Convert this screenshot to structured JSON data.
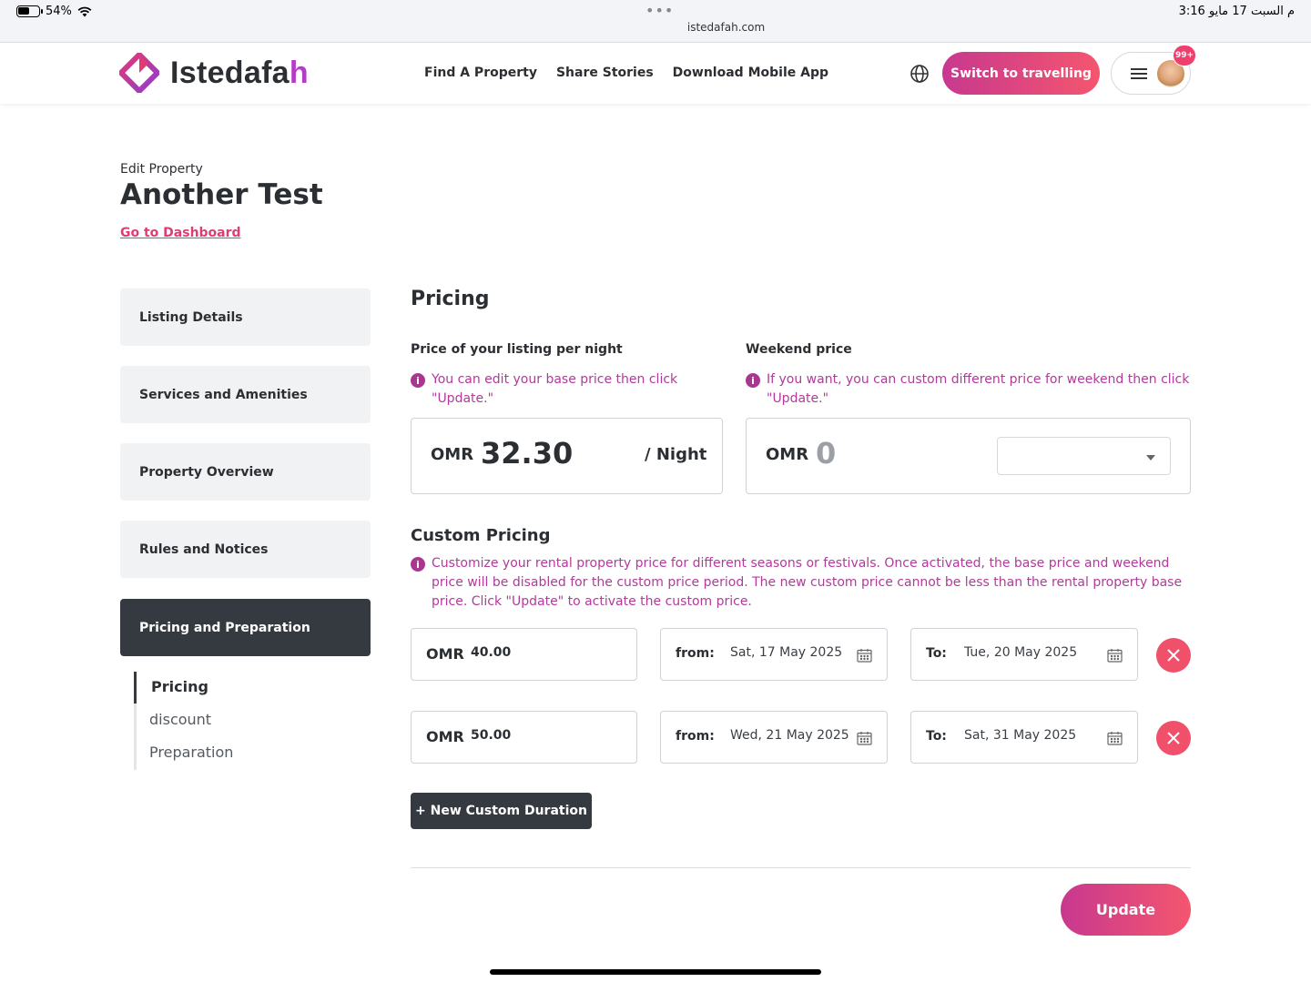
{
  "status_bar": {
    "battery": "54%",
    "url": "istedafah.com",
    "time": "3:16 م  السبت 17 مايو"
  },
  "header": {
    "logo_text_main": "Istedafa",
    "logo_text_accent": "h",
    "nav": [
      "Find A Property",
      "Share Stories",
      "Download Mobile App"
    ],
    "switch_label": "Switch to travelling",
    "badge": "99+"
  },
  "page": {
    "edit_label": "Edit Property",
    "title": "Another Test",
    "dashboard_link": "Go to Dashboard"
  },
  "sidebar": {
    "items": [
      {
        "label": "Listing Details"
      },
      {
        "label": "Services and Amenities"
      },
      {
        "label": "Property Overview"
      },
      {
        "label": "Rules and Notices"
      },
      {
        "label": "Pricing and Preparation"
      }
    ],
    "subitems": [
      "Pricing",
      "discount",
      "Preparation"
    ]
  },
  "pricing": {
    "heading": "Pricing",
    "base_label": "Price of your listing per night",
    "base_info": "You can edit your base price then click \"Update.\"",
    "base_currency": "OMR",
    "base_value": "32.30",
    "per_night": "/ Night",
    "weekend_label": "Weekend price",
    "weekend_info": "If you want, you can custom different price for weekend then click \"Update.\"",
    "weekend_currency": "OMR",
    "weekend_value": "0"
  },
  "custom": {
    "heading": "Custom Pricing",
    "info": "Customize your rental property price for different seasons or festivals. Once activated, the base price and weekend price will be disabled for the custom price period. The new custom price cannot be less than the rental property base price. Click \"Update\" to activate the custom price.",
    "rows": [
      {
        "currency": "OMR",
        "value": "40.00",
        "from_label": "from:",
        "from": "Sat, 17 May 2025",
        "to_label": "To:",
        "to": "Tue, 20 May 2025"
      },
      {
        "currency": "OMR",
        "value": "50.00",
        "from_label": "from:",
        "from": "Wed, 21 May 2025",
        "to_label": "To:",
        "to": "Sat, 31 May 2025"
      }
    ],
    "new_button": "+ New Custom Duration"
  },
  "actions": {
    "update": "Update"
  },
  "colors": {
    "accent_gradient_start": "#c8388f",
    "accent_gradient_end": "#f4566e",
    "info_text": "#b23a9a",
    "dark": "#343a40"
  }
}
